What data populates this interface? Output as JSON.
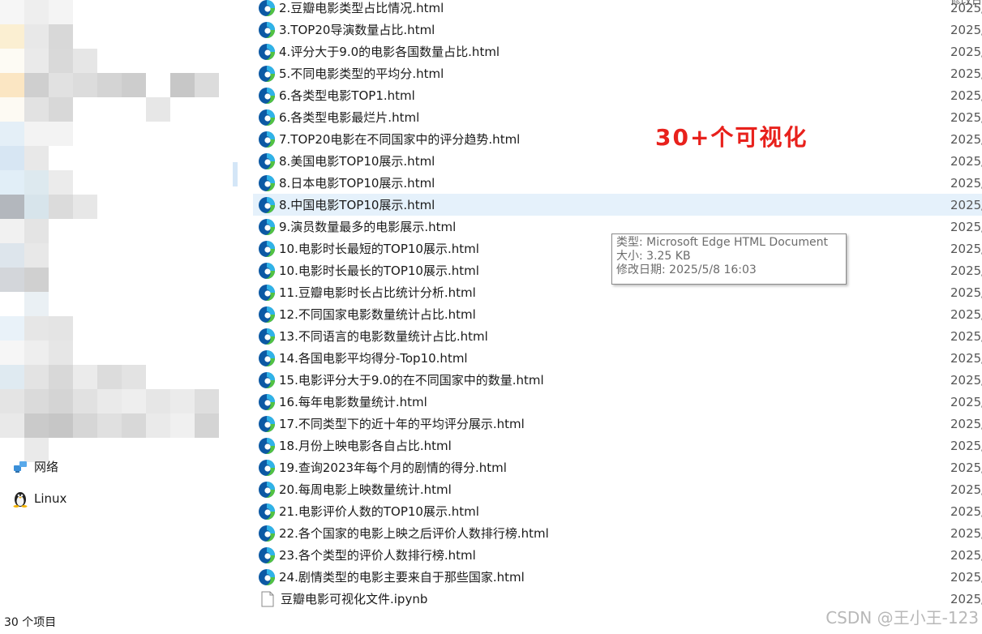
{
  "nav": {
    "pixel_colors": [
      "#f6f6f6",
      "#eeeeee",
      "#f4f4f4",
      "#ffffff",
      "#ffffff",
      "#ffffff",
      "#ffffff",
      "#ffffff",
      "#ffffff",
      "#ffffff",
      "#fbefd2",
      "#e8e8e8",
      "#d8d8d8",
      "#ffffff",
      "#ffffff",
      "#ffffff",
      "#ffffff",
      "#ffffff",
      "#ffffff",
      "#ffffff",
      "#fdfbf4",
      "#eaeaea",
      "#d9d9d9",
      "#e6e6e6",
      "#ffffff",
      "#ffffff",
      "#ffffff",
      "#ffffff",
      "#ffffff",
      "#ffffff",
      "#fbe6c3",
      "#cfcfcf",
      "#e1e1e1",
      "#dcdcdc",
      "#d4d4d4",
      "#cdcdcd",
      "#ffffff",
      "#c7c7c7",
      "#dcdcdc",
      "#ffffff",
      "#fdfaf3",
      "#e2e2e2",
      "#d8d8d8",
      "#ffffff",
      "#ffffff",
      "#ffffff",
      "#e7e7e7",
      "#ffffff",
      "#ffffff",
      "#ffffff",
      "#e4eff7",
      "#f3f3f3",
      "#f3f3f3",
      "#ffffff",
      "#ffffff",
      "#ffffff",
      "#ffffff",
      "#ffffff",
      "#ffffff",
      "#ffffff",
      "#d7e6f3",
      "#e8e8e8",
      "#ffffff",
      "#ffffff",
      "#ffffff",
      "#ffffff",
      "#ffffff",
      "#ffffff",
      "#ffffff",
      "#ffffff",
      "#e1eef7",
      "#dde9ef",
      "#ebebeb",
      "#ffffff",
      "#ffffff",
      "#ffffff",
      "#ffffff",
      "#ffffff",
      "#ffffff",
      "#ffffff",
      "#b3b7bd",
      "#d7e4eb",
      "#dbdbdb",
      "#e7e7e7",
      "#ffffff",
      "#ffffff",
      "#ffffff",
      "#ffffff",
      "#ffffff",
      "#ffffff",
      "#f1f1f1",
      "#e4e4e4",
      "#ffffff",
      "#ffffff",
      "#ffffff",
      "#ffffff",
      "#ffffff",
      "#ffffff",
      "#ffffff",
      "#ffffff",
      "#dde5ec",
      "#e8e8e8",
      "#ffffff",
      "#ffffff",
      "#ffffff",
      "#ffffff",
      "#ffffff",
      "#ffffff",
      "#ffffff",
      "#ffffff",
      "#d3d6da",
      "#d0d0d0",
      "#ffffff",
      "#ffffff",
      "#ffffff",
      "#ffffff",
      "#ffffff",
      "#ffffff",
      "#ffffff",
      "#ffffff",
      "#ffffff",
      "#eaf0f4",
      "#ffffff",
      "#ffffff",
      "#ffffff",
      "#ffffff",
      "#ffffff",
      "#ffffff",
      "#ffffff",
      "#ffffff",
      "#e9f2f9",
      "#e6e6e6",
      "#e4e4e4",
      "#ffffff",
      "#ffffff",
      "#ffffff",
      "#ffffff",
      "#ffffff",
      "#ffffff",
      "#ffffff",
      "#f6f6f6",
      "#eeeeee",
      "#e6e6e6",
      "#ffffff",
      "#ffffff",
      "#ffffff",
      "#ffffff",
      "#ffffff",
      "#ffffff",
      "#ffffff",
      "#dfeaf1",
      "#e3e3e3",
      "#d8d8d8",
      "#ebebeb",
      "#dcdcdc",
      "#e3e3e3",
      "#ffffff",
      "#ffffff",
      "#ffffff",
      "#ffffff",
      "#e4e4e4",
      "#dadada",
      "#d4d4d4",
      "#e1e1e1",
      "#eaeaea",
      "#eeeeee",
      "#e6e6e6",
      "#ebebeb",
      "#dedede",
      "#ffffff",
      "#e9e9e9",
      "#cacaca",
      "#c6c6c6",
      "#d6d6d6",
      "#e0e0e0",
      "#d8d8d8",
      "#eaeaea",
      "#f0f0f0",
      "#d4d4d4",
      "#ffffff",
      "#ffffff",
      "#eaeaea",
      "#ffffff",
      "#ffffff",
      "#ffffff",
      "#ffffff",
      "#ffffff",
      "#ffffff",
      "#ffffff",
      "#ffffff"
    ],
    "network_label": "网络",
    "linux_label": "Linux"
  },
  "header": {
    "date_header": "修改日"
  },
  "files": [
    {
      "name": "2.豆瓣电影类型占比情况.html",
      "date": "2025/",
      "type": "edge"
    },
    {
      "name": "3.TOP20导演数量占比.html",
      "date": "2025/",
      "type": "edge"
    },
    {
      "name": "4.评分大于9.0的电影各国数量占比.html",
      "date": "2025/",
      "type": "edge"
    },
    {
      "name": "5.不同电影类型的平均分.html",
      "date": "2025/",
      "type": "edge"
    },
    {
      "name": "6.各类型电影TOP1.html",
      "date": "2025/",
      "type": "edge"
    },
    {
      "name": "6.各类型电影最烂片.html",
      "date": "2025/",
      "type": "edge"
    },
    {
      "name": "7.TOP20电影在不同国家中的评分趋势.html",
      "date": "2025/",
      "type": "edge"
    },
    {
      "name": "8.美国电影TOP10展示.html",
      "date": "2025/",
      "type": "edge"
    },
    {
      "name": "8.日本电影TOP10展示.html",
      "date": "2025/",
      "type": "edge"
    },
    {
      "name": "8.中国电影TOP10展示.html",
      "date": "2025/",
      "type": "edge",
      "selected": true
    },
    {
      "name": "9.演员数量最多的电影展示.html",
      "date": "2025/",
      "type": "edge"
    },
    {
      "name": "10.电影时长最短的TOP10展示.html",
      "date": "2025/",
      "type": "edge"
    },
    {
      "name": "10.电影时长最长的TOP10展示.html",
      "date": "2025/",
      "type": "edge"
    },
    {
      "name": "11.豆瓣电影时长占比统计分析.html",
      "date": "2025/",
      "type": "edge"
    },
    {
      "name": "12.不同国家电影数量统计占比.html",
      "date": "2025/",
      "type": "edge"
    },
    {
      "name": "13.不同语言的电影数量统计占比.html",
      "date": "2025/",
      "type": "edge"
    },
    {
      "name": "14.各国电影平均得分-Top10.html",
      "date": "2025/",
      "type": "edge"
    },
    {
      "name": "15.电影评分大于9.0的在不同国家中的数量.html",
      "date": "2025/",
      "type": "edge"
    },
    {
      "name": "16.每年电影数量统计.html",
      "date": "2025/",
      "type": "edge"
    },
    {
      "name": "17.不同类型下的近十年的平均评分展示.html",
      "date": "2025/",
      "type": "edge"
    },
    {
      "name": "18.月份上映电影各自占比.html",
      "date": "2025/",
      "type": "edge"
    },
    {
      "name": "19.查询2023年每个月的剧情的得分.html",
      "date": "2025/",
      "type": "edge"
    },
    {
      "name": "20.每周电影上映数量统计.html",
      "date": "2025/",
      "type": "edge"
    },
    {
      "name": "21.电影评价人数的TOP10展示.html",
      "date": "2025/",
      "type": "edge"
    },
    {
      "name": "22.各个国家的电影上映之后评价人数排行榜.html",
      "date": "2025/",
      "type": "edge"
    },
    {
      "name": "23.各个类型的评价人数排行榜.html",
      "date": "2025/",
      "type": "edge"
    },
    {
      "name": "24.剧情类型的电影主要来自于那些国家.html",
      "date": "2025/",
      "type": "edge"
    },
    {
      "name": "豆瓣电影可视化文件.ipynb",
      "date": "2025/",
      "type": "doc"
    }
  ],
  "overlay": {
    "text": "30+个可视化",
    "color": "#e8211c"
  },
  "tooltip": {
    "type_line": "类型: Microsoft Edge HTML Document",
    "size_line": "大小: 3.25 KB",
    "date_line": "修改日期: 2025/5/8 16:03"
  },
  "status": {
    "item_count": "30 个项目"
  },
  "watermark": "CSDN @王小王-123",
  "colors": {
    "selection": "#e5f1fb",
    "edge_blue": "#0c59a4",
    "edge_green": "#52c341"
  }
}
